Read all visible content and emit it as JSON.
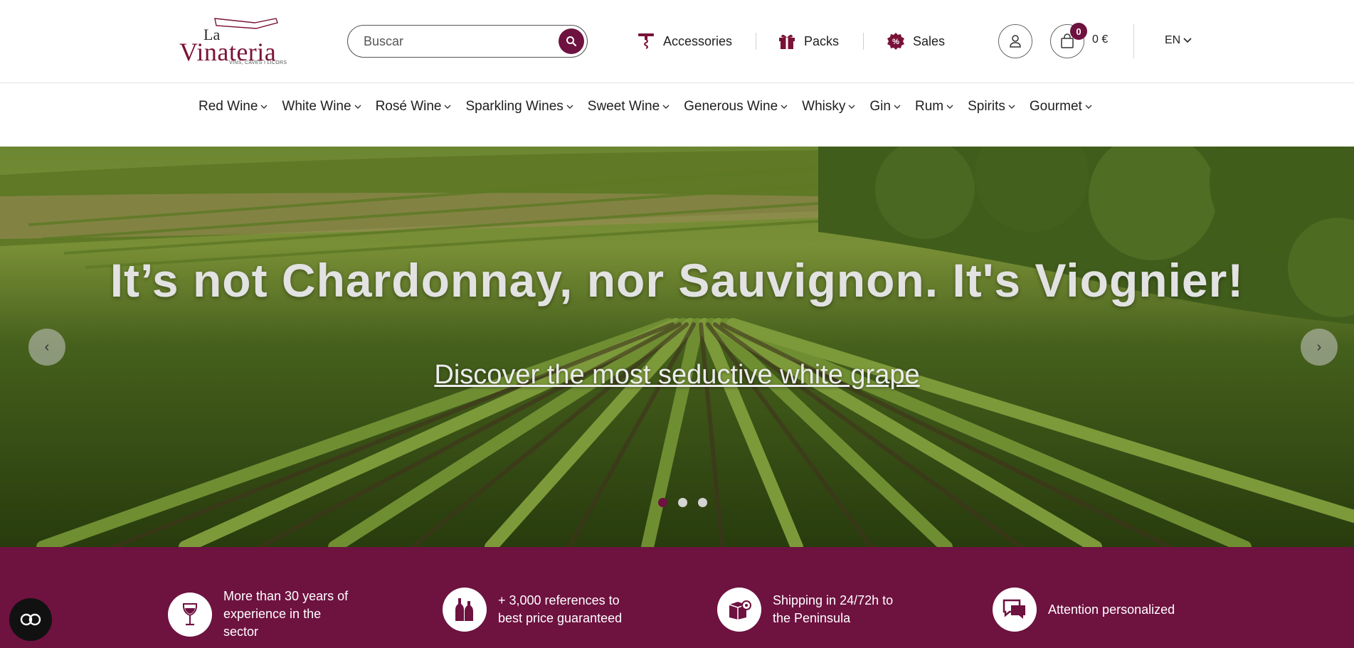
{
  "header": {
    "logo": {
      "la": "La",
      "name": "Vinateria",
      "tagline": "VINS, CAVES I LICORS"
    },
    "search": {
      "placeholder": "Buscar"
    },
    "quick_links": [
      {
        "label": "Accessories",
        "icon": "corkscrew-icon"
      },
      {
        "label": "Packs",
        "icon": "gift-icon"
      },
      {
        "label": "Sales",
        "icon": "percent-badge-icon"
      }
    ],
    "cart": {
      "count": "0",
      "total": "0 €"
    },
    "language": "EN"
  },
  "nav": {
    "items": [
      "Red Wine",
      "White Wine",
      "Rosé Wine",
      "Sparkling Wines",
      "Sweet Wine",
      "Generous Wine",
      "Whisky",
      "Gin",
      "Rum",
      "Spirits",
      "Gourmet"
    ]
  },
  "hero": {
    "headline": "It’s not Chardonnay, nor Sauvignon. It's Viognier!",
    "link": "Discover the most seductive white grape",
    "slide_count": 3,
    "active_slide": 1
  },
  "features": [
    {
      "text": "More than 30 years of experience in the sector",
      "icon": "wine-glass-icon"
    },
    {
      "text": "+ 3,000 references to best price guaranteed",
      "icon": "bottles-icon"
    },
    {
      "text": "Shipping in 24/72h to the Peninsula",
      "icon": "shipping-box-icon"
    },
    {
      "text": "Attention personalized",
      "icon": "chat-icon"
    }
  ],
  "colors": {
    "brand": "#6e1240",
    "text": "#1e1e1e",
    "hero_text": "#e2e2e2"
  }
}
